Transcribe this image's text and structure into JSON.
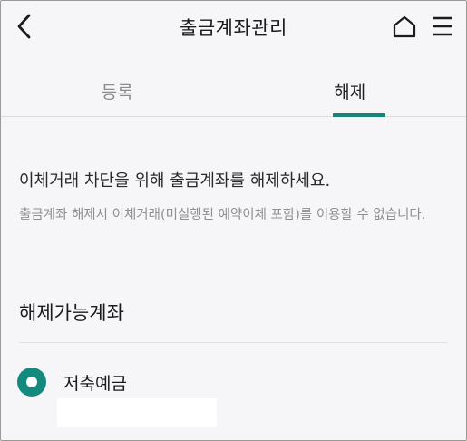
{
  "header": {
    "title": "출금계좌관리",
    "back_icon": "chevron-left-icon",
    "home_icon": "home-icon",
    "menu_icon": "hamburger-menu-icon"
  },
  "tabs": [
    {
      "label": "등록",
      "selected": false
    },
    {
      "label": "해제",
      "selected": true
    }
  ],
  "colors": {
    "accent": "#13857a",
    "background": "#f6f6f8",
    "muted_text": "#8f8f8f"
  },
  "content": {
    "main_text": "이체거래 차단을 위해 출금계좌를 해제하세요.",
    "sub_text": "출금계좌 해제시 이체거래(미실행된 예약이체 포함)를 이용할 수 없습니다.",
    "section_title": "해제가능계좌"
  },
  "accounts": [
    {
      "name": "저축예금",
      "selected": true
    }
  ]
}
